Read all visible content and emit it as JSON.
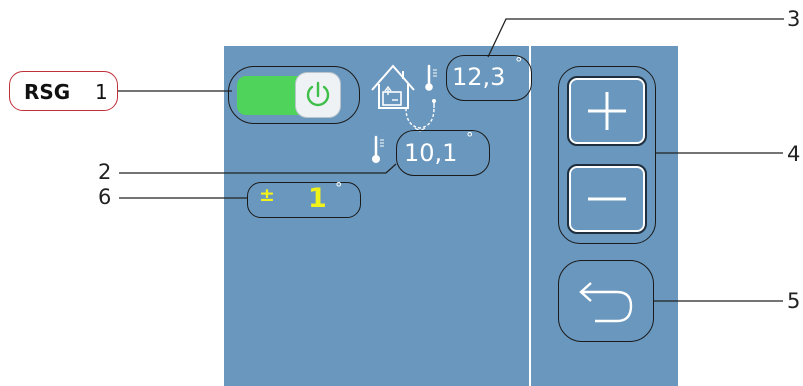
{
  "device_label": "RSG",
  "callouts": [
    "1",
    "2",
    "3",
    "4",
    "5",
    "6"
  ],
  "temp_outdoor": "12,3",
  "temp_indoor": "10,1",
  "degree_symbol": "°",
  "offset": {
    "sign": "±",
    "value": "1",
    "unit": "°"
  },
  "colors": {
    "panel": "#6a97bd",
    "toggle_on": "#4fd35a",
    "offset_text": "#f2f21b",
    "frame_label": "#c0303a"
  },
  "icons": [
    "power-icon",
    "house-circuit-icon",
    "thermometer-icon",
    "plus-icon",
    "minus-icon",
    "back-arrow-icon"
  ]
}
